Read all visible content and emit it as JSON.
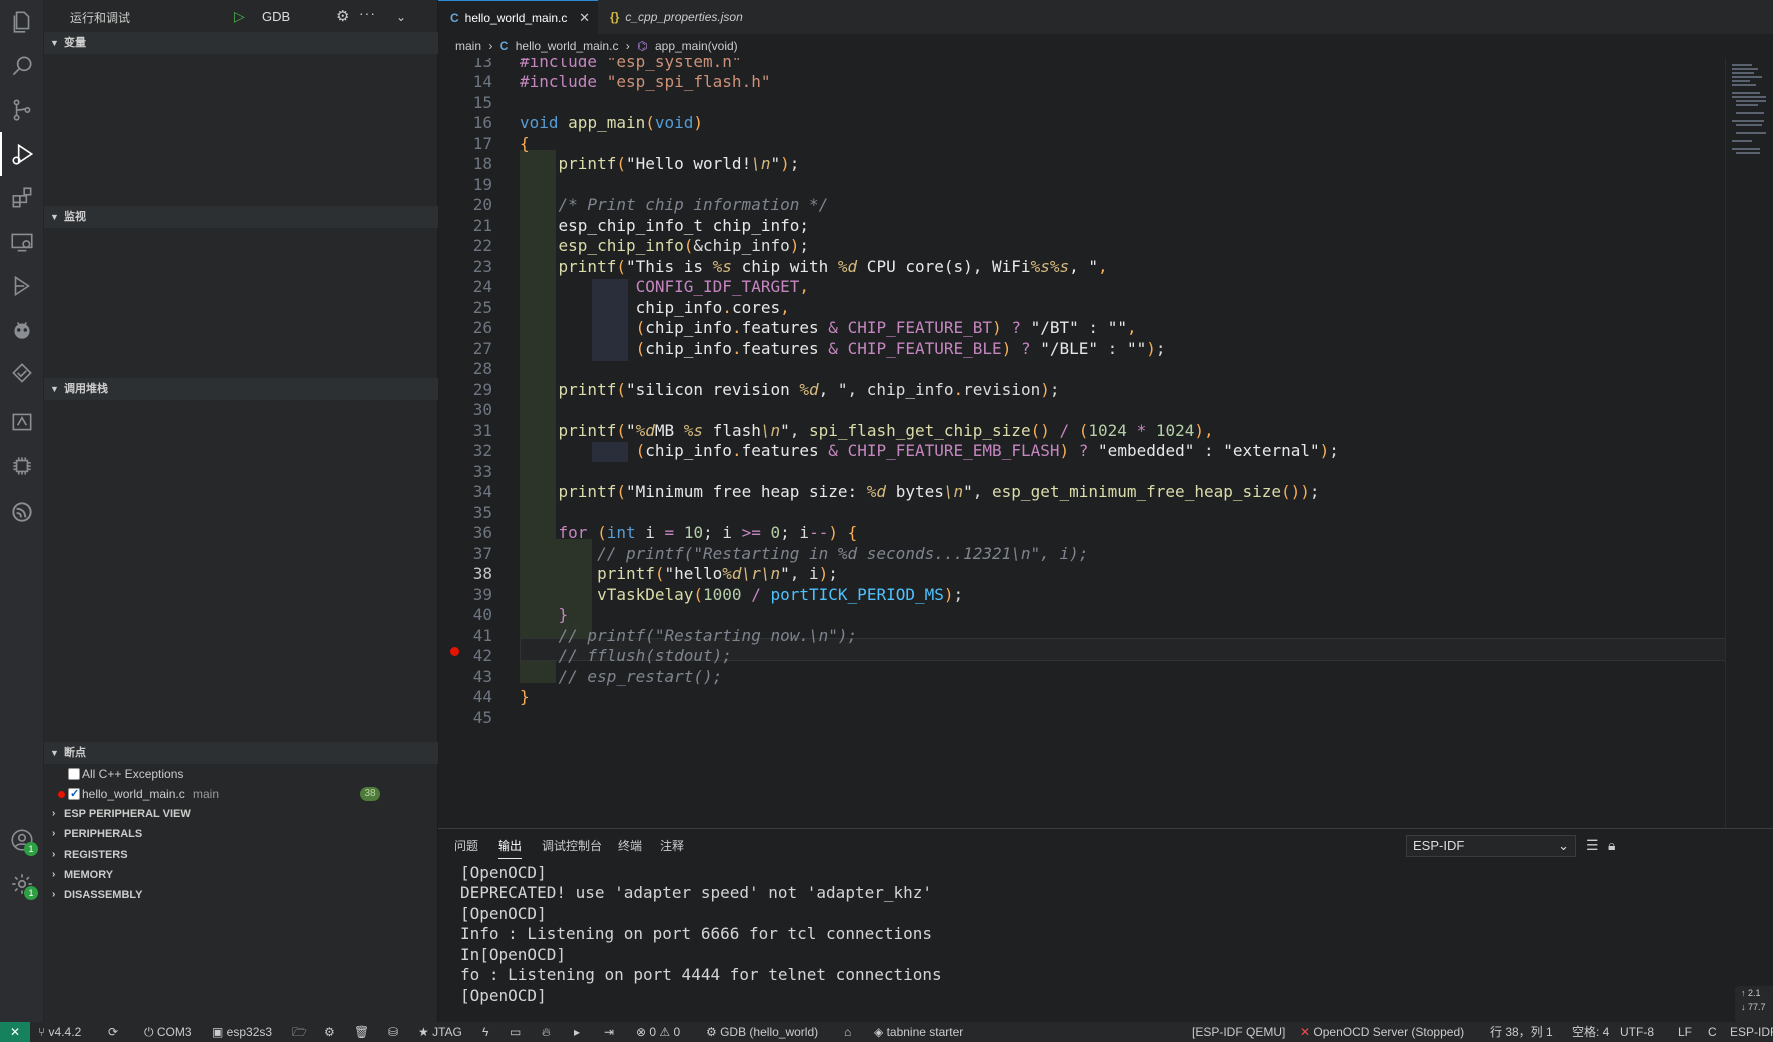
{
  "activity_bar": {
    "icons": [
      "files-icon",
      "search-icon",
      "source-control-icon",
      "run-debug-icon",
      "extensions-icon",
      "remote-explorer-icon",
      "esp-idf-explorer-icon",
      "platformio-icon",
      "testing-icon",
      "idf-component-icon",
      "chip-icon",
      "espressif-icon",
      "account-icon",
      "settings-icon"
    ],
    "account_badge": "1",
    "settings_badge": "1"
  },
  "sidebar": {
    "title": "运行和调试",
    "run_config": "GDB",
    "sections": {
      "variables": "变量",
      "watch": "监视",
      "call_stack": "调用堆栈",
      "breakpoints": "断点"
    },
    "breakpoints": [
      {
        "label": "All C++ Exceptions",
        "checked": false
      },
      {
        "label": "hello_world_main.c",
        "detail": "main",
        "checked": true,
        "line": "38"
      }
    ],
    "extra_sections": [
      "ESP PERIPHERAL VIEW",
      "PERIPHERALS",
      "REGISTERS",
      "MEMORY",
      "DISASSEMBLY"
    ]
  },
  "tabs": [
    {
      "label": "hello_world_main.c",
      "icon": "C",
      "active": true
    },
    {
      "label": "c_cpp_properties.json",
      "icon": "{}",
      "active": false
    }
  ],
  "breadcrumb": {
    "folder": "main",
    "file": "hello_world_main.c",
    "symbol": "app_main(void)"
  },
  "editor": {
    "line_numbers": [
      "13",
      "14",
      "15",
      "16",
      "17",
      "18",
      "19",
      "20",
      "21",
      "22",
      "23",
      "24",
      "25",
      "26",
      "27",
      "28",
      "29",
      "30",
      "31",
      "32",
      "33",
      "34",
      "35",
      "36",
      "37",
      "38",
      "39",
      "40",
      "41",
      "42",
      "43",
      "44",
      "45"
    ],
    "current_line": "38"
  },
  "panel": {
    "tabs": [
      "问题",
      "输出",
      "调试控制台",
      "终端",
      "注释"
    ],
    "active_tab": "输出",
    "channel": "ESP-IDF",
    "output": [
      "[OpenOCD]",
      "DEPRECATED! use 'adapter speed' not 'adapter_khz'",
      "[OpenOCD]",
      "Info : Listening on port 6666 for tcl connections",
      "In[OpenOCD]",
      "fo : Listening on port 4444 for telnet connections",
      "[OpenOCD]"
    ],
    "notify_lines": [
      "↑ 2.1",
      "↓ 77.7"
    ]
  },
  "status_bar": {
    "remote": "✕",
    "items_left": [
      {
        "icon": "branch-icon",
        "label": "v4.4.2"
      },
      {
        "icon": "sync-icon",
        "label": ""
      },
      {
        "icon": "plug-icon",
        "label": "COM3"
      },
      {
        "icon": "chip-target-icon",
        "label": "esp32s3"
      },
      {
        "icon": "folder-icon",
        "label": ""
      },
      {
        "icon": "gear-icon",
        "label": ""
      },
      {
        "icon": "trash-icon",
        "label": ""
      },
      {
        "icon": "database-icon",
        "label": ""
      },
      {
        "icon": "star-icon",
        "label": "JTAG"
      },
      {
        "icon": "flash-icon",
        "label": ""
      },
      {
        "icon": "monitor-icon",
        "label": ""
      },
      {
        "icon": "flame-icon",
        "label": ""
      },
      {
        "icon": "terminal-icon",
        "label": ""
      },
      {
        "icon": "run-icon",
        "label": ""
      },
      {
        "icon": "problems-icon",
        "label": "⊗ 0 ⚠ 0"
      },
      {
        "icon": "debug-icon",
        "label": "GDB (hello_world)"
      },
      {
        "icon": "home-icon",
        "label": ""
      },
      {
        "icon": "tabnine-icon",
        "label": "tabnine starter"
      }
    ],
    "items_right": [
      {
        "label": "[ESP-IDF QEMU]"
      },
      {
        "label": "OpenOCD Server (Stopped)"
      },
      {
        "label": "行 38，列 1"
      },
      {
        "label": "空格: 4"
      },
      {
        "label": "UTF-8"
      },
      {
        "label": "LF"
      },
      {
        "label": "C"
      },
      {
        "label": "ESP-IDF"
      }
    ]
  },
  "colors": {
    "accent": "#2a8cd8",
    "breakpoint": "#e51400",
    "remote": "#16825d"
  }
}
